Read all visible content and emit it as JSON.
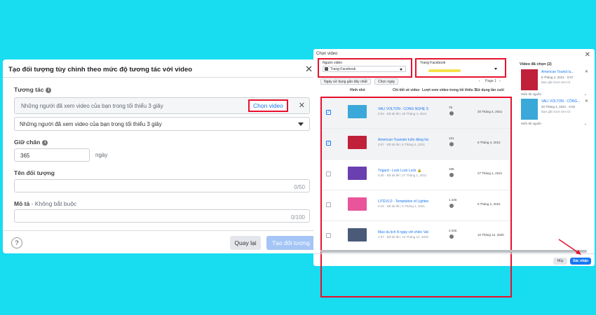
{
  "left_dialog": {
    "title": "Tạo đối tượng tùy chỉnh theo mức độ tương tác với video",
    "close": "✕",
    "engagement_label": "Tương tác",
    "selected_text": "Những người đã xem video của bạn trong tối thiểu 3 giây",
    "choose_video": "Chọn video",
    "clear": "✕",
    "dropdown_value": "Những người đã xem video của bạn trong tối thiểu 3 giây",
    "retention_label": "Giữ chân",
    "retention_value": "365",
    "retention_unit": "ngày",
    "audience_name_label": "Tên đối tượng",
    "audience_name_counter": "0/50",
    "description_label": "Mô tả",
    "description_optional": " - Không bắt buộc",
    "description_counter": "0/100",
    "help": "?",
    "back_button": "Quay lại",
    "create_button": "Tạo đối tượng"
  },
  "right_dialog": {
    "title": "Chọn video",
    "close": "✕",
    "source_label": "Nguồn video",
    "source_value": "Trang Facebook",
    "page_label": "Trang Facebook",
    "sort_chip": "Ngày sử dụng gần đây nhất",
    "date_chip": "Chọn ngày",
    "pager": "Page 1",
    "columns": [
      "Hình nhỏ",
      "Chi tiết về video",
      "Lượt xem video trong tối thiểu 3",
      "Sử dụng lần cuối"
    ],
    "rows": [
      {
        "title": "VALI VOLTON - CÔNG NGHỆ STOP...",
        "meta": "0:03 · Đã tải lên: 20 Tháng 4, 2021",
        "views": "78",
        "last_used": "20 Tháng 4, 2021",
        "checked": true,
        "thumb_color": "#3aa8d8"
      },
      {
        "title": "American Tourister luôn đồng hàn...",
        "meta": "0:07 · Đã tải lên: 6 Tháng 4, 2021",
        "views": "131",
        "last_used": "6 Tháng 4, 2021",
        "checked": true,
        "thumb_color": "#c0203a"
      },
      {
        "title": "Trigard - Lock Lock Lock 🔒",
        "meta": "0:30 · Đã tải lên: 27 Tháng 1, 2021",
        "views": "195",
        "last_used": "27 Tháng 1, 2021",
        "checked": false,
        "thumb_color": "#6a3fb0"
      },
      {
        "title": "LITEVLO - Temptation of Lightwei...",
        "meta": "0:15 · Đã tải lên: 5 Tháng 1, 2021",
        "views": "1 226",
        "last_used": "5 Tháng 1, 2021",
        "checked": false,
        "thumb_color": "#e8559a"
      },
      {
        "title": "Mao du lịch 8 ngày với chiếc Vali...",
        "meta": "1:07 · Đã tải lên: 10 Tháng 12, 2020",
        "views": "2 025",
        "last_used": "10 Tháng 12, 2020",
        "checked": false,
        "thumb_color": "#4a5a78"
      }
    ],
    "selected_title": "Video đã chọn (2)",
    "selected": [
      {
        "name": "American Tourist lu...",
        "date": "6 Tháng 4, 2021 · 0:07",
        "sub": "Bạn gần lượt xem từ",
        "hide": "Hiển thị nguồn",
        "color": "#c0203a"
      },
      {
        "name": "VALI VOLTON - CÔNG...",
        "date": "20 Tháng 4, 2021 · 0:03",
        "sub": "Bạn gần lượt xem từ",
        "hide": "Hiển thị nguồn",
        "color": "#3aa8d8"
      }
    ],
    "cancel_button": "Hủy",
    "confirm_button": "Xác nhận"
  }
}
